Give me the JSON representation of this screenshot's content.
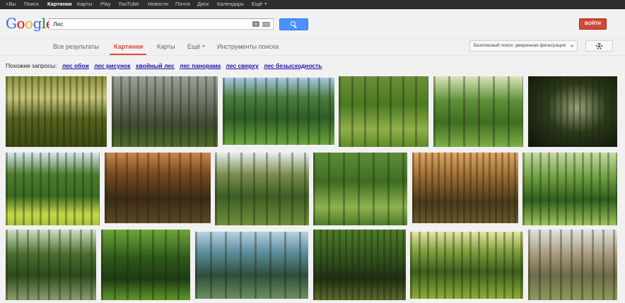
{
  "topbar": {
    "items": [
      {
        "label": "+Вы",
        "active": false
      },
      {
        "label": "Поиск",
        "active": false
      },
      {
        "label": "Картинки",
        "active": true
      },
      {
        "label": "Карты",
        "active": false
      },
      {
        "label": "Play",
        "active": false
      },
      {
        "label": "YouTube",
        "active": false
      },
      {
        "label": "Новости",
        "active": false
      },
      {
        "label": "Почта",
        "active": false
      },
      {
        "label": "Диск",
        "active": false
      },
      {
        "label": "Календарь",
        "active": false
      },
      {
        "label": "Ещё",
        "active": false
      }
    ]
  },
  "header": {
    "logo": "Google",
    "search_value": "Лес",
    "signin_label": "ВОЙТИ"
  },
  "nav": {
    "tabs": [
      {
        "label": "Все результаты"
      },
      {
        "label": "Картинки"
      },
      {
        "label": "Карты"
      },
      {
        "label": "Ещё"
      },
      {
        "label": "Инструменты поиска"
      }
    ],
    "safe_search": "Безопасный поиск: умеренная фильтрация"
  },
  "related": {
    "label": "Похожие запросы:",
    "links": [
      "лес обои",
      "лес рисунок",
      "хвойный лес",
      "лес панорама",
      "лес сверху",
      "лес безысходность"
    ]
  },
  "images": [
    {
      "bg": "linear-gradient(180deg,#8a8f3a 0%,#c9c67a 30%,#56631e 60%,#3a4a10 100%)"
    },
    {
      "bg": "linear-gradient(180deg,#9ea29a 0%,#6d7468 35%,#3b4a2c 70%,#4f6d2a 100%)"
    },
    {
      "bg": "linear-gradient(180deg,#a9c9e6 0%,#4b7e3c 30%,#2e5d26 60%,#6aa63c 100%)"
    },
    {
      "bg": "linear-gradient(180deg,#6b8f3a 0%,#4c7a20 40%,#8fb04a 75%,#5d8a2a 100%)"
    },
    {
      "bg": "linear-gradient(180deg,#d8e6b8 0%,#5e8e37 35%,#3f6e22 65%,#7fae46 100%)"
    },
    {
      "bg": "radial-gradient(ellipse at 55% 45%,#9aa27a 0%,#2a3a1a 45%,#0c120a 100%)"
    },
    {
      "bg": "linear-gradient(180deg,#d9e8f2 0%,#4d7c2c 30%,#3b6a20 60%,#c6d84a 85%,#a9c23a 100%)"
    },
    {
      "bg": "linear-gradient(180deg,#c8884a 0%,#7a4a22 30%,#3a2a16 65%,#5a4a24 100%)"
    },
    {
      "bg": "linear-gradient(180deg,#e8eef0 0%,#7a8f4e 30%,#3d5e24 60%,#6e8e3c 100%)"
    },
    {
      "bg": "linear-gradient(180deg,#5f8e3a 0%,#3e6c22 40%,#8eb24e 75%,#4c7a2a 100%)"
    },
    {
      "bg": "linear-gradient(180deg,#e0a664 0%,#9a6a32 35%,#4a3a1a 70%,#6a5a2a 100%)"
    },
    {
      "bg": "linear-gradient(180deg,#c6dca2 0%,#6e9e3e 35%,#2e5e1e 65%,#9ec45a 100%)"
    },
    {
      "bg": "linear-gradient(180deg,#cfe0c8 0%,#4a6e2e 35%,#2e4a1c 65%,#8e9e6e 100%)"
    },
    {
      "bg": "linear-gradient(180deg,#6fa63a 0%,#2e5a1a 40%,#1e3a12 70%,#5e9a2a 100%)"
    },
    {
      "bg": "linear-gradient(180deg,#b8d4e2 0%,#5e8e9e 30%,#2e4e3e 65%,#6e8e5e 100%)"
    },
    {
      "bg": "linear-gradient(180deg,#4e7e2a 0%,#2e4e1a 45%,#1e2e12 70%,#5e6e2e 100%)"
    },
    {
      "bg": "linear-gradient(180deg,#e8e6a4 0%,#7e9e3a 30%,#3e5e1e 60%,#8eae3a 100%)"
    },
    {
      "bg": "linear-gradient(180deg,#dfe4e0 0%,#a89a7e 35%,#6e6a4a 65%,#8e9a5e 100%)"
    }
  ]
}
